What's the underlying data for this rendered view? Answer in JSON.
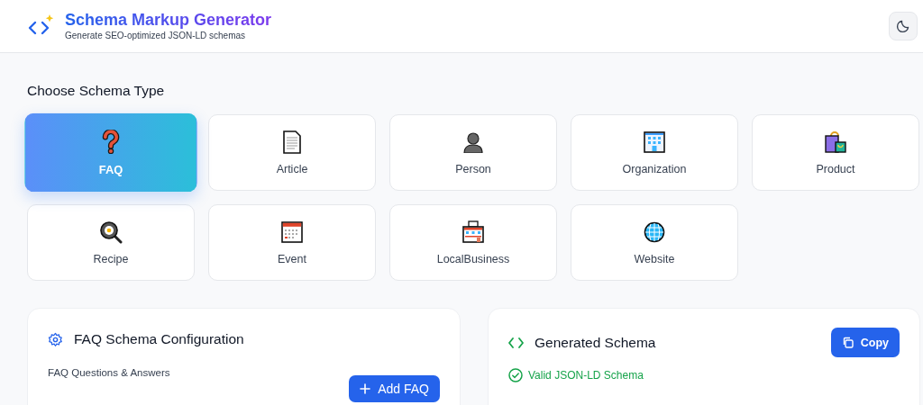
{
  "header": {
    "title": "Schema Markup Generator",
    "subtitle": "Generate SEO-optimized JSON-LD schemas"
  },
  "section_title": "Choose Schema Type",
  "schema_types": [
    {
      "label": "FAQ",
      "kind": "question",
      "selected": true
    },
    {
      "label": "Article",
      "kind": "document",
      "selected": false
    },
    {
      "label": "Person",
      "kind": "person",
      "selected": false
    },
    {
      "label": "Organization",
      "kind": "building",
      "selected": false
    },
    {
      "label": "Product",
      "kind": "bag",
      "selected": false
    },
    {
      "label": "Recipe",
      "kind": "pan",
      "selected": false
    },
    {
      "label": "Event",
      "kind": "calendar",
      "selected": false
    },
    {
      "label": "LocalBusiness",
      "kind": "store",
      "selected": false
    },
    {
      "label": "Website",
      "kind": "globe",
      "selected": false
    }
  ],
  "config_panel": {
    "title": "FAQ Schema Configuration",
    "subtitle": "FAQ Questions & Answers",
    "add_button": "Add FAQ"
  },
  "output_panel": {
    "title": "Generated Schema",
    "copy_button": "Copy",
    "status": "Valid JSON-LD Schema"
  }
}
